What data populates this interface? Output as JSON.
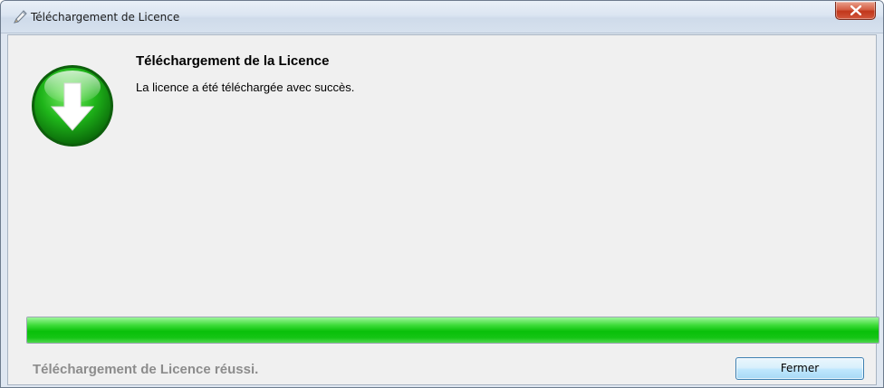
{
  "window": {
    "title": "Téléchargement de Licence"
  },
  "content": {
    "heading": "Téléchargement de la Licence",
    "message": "La licence a été téléchargée avec succès."
  },
  "progress": {
    "percent": 100
  },
  "footer": {
    "status": "Téléchargement de Licence réussi.",
    "close_label": "Fermer"
  },
  "icons": {
    "title": "pencil-icon",
    "close": "close-icon",
    "success": "download-success-icon"
  },
  "colors": {
    "progress_fill": "#14c514",
    "close_button_red": "#c1371b",
    "status_text": "#8c8c8c"
  }
}
